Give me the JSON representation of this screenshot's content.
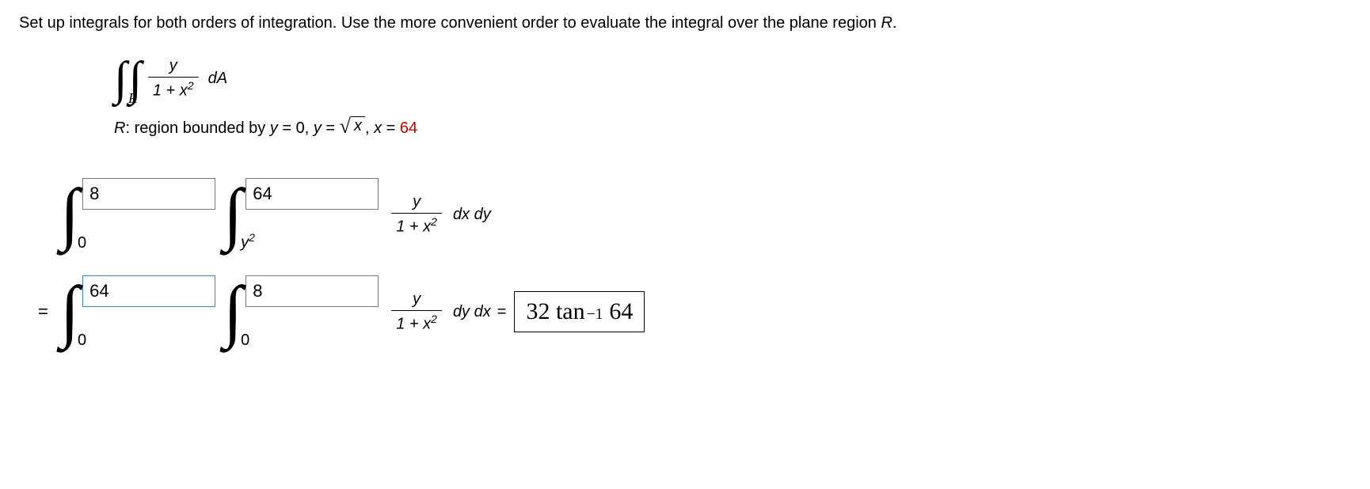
{
  "prompt_text": "Set up integrals for both orders of integration. Use the more convenient order to evaluate the integral over the plane region ",
  "region_var": "R",
  "period": ".",
  "integral": {
    "sub": "R",
    "frac_num": "y",
    "frac_den_pre": "1 + ",
    "frac_den_var": "x",
    "frac_den_sup": "2",
    "dA": "dA"
  },
  "region_desc": {
    "prefix": "R",
    "mid": ": region bounded by ",
    "eq1_lhs": "y",
    "eq1_rhs": " = 0, ",
    "eq2_lhs": "y",
    "eq2_eq": " = ",
    "sqrt_arg": "x",
    "eq3": ", ",
    "eq3_lhs": "x",
    "eq3_eq": " = ",
    "eq3_rhs": "64"
  },
  "row1": {
    "outer_low": "0",
    "outer_up_input": "8",
    "inner_low_var": "y",
    "inner_low_sup": "2",
    "inner_up_input": "64",
    "differential": "dx dy"
  },
  "row2": {
    "eq": "=",
    "outer_low": "0",
    "outer_up_input": "64",
    "inner_low": "0",
    "inner_up_input": "8",
    "differential": "dy dx",
    "result_eq": " = ",
    "result_coef": "32 tan",
    "result_exp": "−1",
    "result_arg": "64"
  }
}
